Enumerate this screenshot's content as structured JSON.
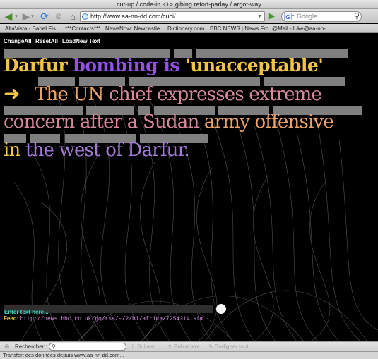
{
  "window": {
    "title": "cut-up / code-in <+> gibing retort-parlay / argot-way"
  },
  "toolbar": {
    "back_icon": "back-arrow-icon",
    "forward_icon": "forward-arrow-icon",
    "reload_icon": "reload-icon",
    "stop_icon": "stop-icon",
    "home_icon": "home-icon",
    "url": "http://www.aa-nn-dd.com/cuci/",
    "search_placeholder": "Google",
    "search_engine_letter": "G"
  },
  "bookmarks": [
    "AltaVista - Babel Fis...",
    "***Contacts***",
    "NewsNow: Newcastle ...",
    "Dictionary.com",
    "BBC NEWS | News Fro...",
    "@Mail - luke@aa-nn-..."
  ],
  "commands": {
    "change_all": "ChangeAll",
    "reset_all": "ResetAll",
    "load_new": "LoadNew Text"
  },
  "headline": {
    "w1": "Darfur",
    "w2": "bombing is",
    "w3": "'unacceptable'"
  },
  "body": {
    "arrow": "➜",
    "l2a": "The UN",
    "l2b": "chief expresses extreme",
    "l3a": "concern after a",
    "l3b": "Sudan",
    "l3c": "army offensive",
    "l4a": "in",
    "l4b": "the west of",
    "l4c": "Darfur."
  },
  "colors": {
    "yellow": "#f3c443",
    "purple": "#9452e4",
    "orange": "#eea466",
    "pink": "#d7889a",
    "lavender": "#a37ad6",
    "gray_bar": "#7f7f7f",
    "input_text": "#3fd0c0"
  },
  "input": {
    "placeholder": "Enter text here..."
  },
  "feed": {
    "label": "Feed:",
    "url": "http://news.bbc.co.uk/go/rss/-/2/hi/africa/7254314.stm"
  },
  "findbar": {
    "close_icon": "close-icon",
    "label": "Rechercher :",
    "search_icon": "magnifier-icon",
    "next": "Suivant",
    "previous": "Précédent",
    "highlight": "Surligner tout"
  },
  "status": {
    "text": "Transfert des données depuis www.aa-nn-dd.com..."
  }
}
